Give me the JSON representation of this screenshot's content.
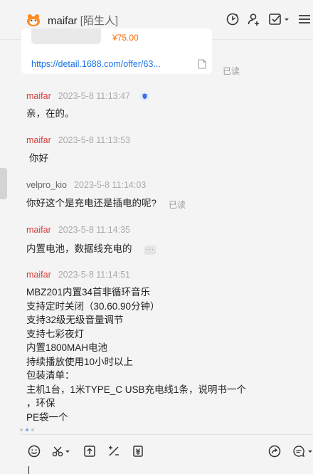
{
  "header": {
    "name": "maifar",
    "tag": "[陌生人]"
  },
  "product_card": {
    "price": "¥75.00",
    "link": "https://detail.1688.com/offer/63...",
    "read_status": "已读"
  },
  "messages": [
    {
      "sender": "maifar",
      "time": "2023-5-8 11:13:47",
      "text": "亲，在的。"
    },
    {
      "sender": "maifar",
      "time": "2023-5-8 11:13:53",
      "text": "你好"
    },
    {
      "sender": "velpro_kio",
      "time": "2023-5-8 11:14:03",
      "text": "你好这个是充电还是插电的呢?",
      "read_status": "已读"
    },
    {
      "sender": "maifar",
      "time": "2023-5-8 11:14:35",
      "text": "内置电池，数据线充电的"
    },
    {
      "sender": "maifar",
      "time": "2023-5-8 11:14:51",
      "lines": [
        "MBZ201内置34首非循环音乐",
        "支持定时关闭（30.60.90分钟）",
        "支持32级无级音量调节",
        "支持七彩夜灯",
        "内置1800MAH电池",
        "持续播放使用10小时以上",
        "包装清单：",
        "主机1台，1米TYPE_C USB充电线1条，说明书一个",
        "，环保",
        "PE袋一个"
      ]
    }
  ],
  "colors": {
    "seller_name": "#d43f3a",
    "link": "#1a73e8",
    "price": "#ff6a00"
  }
}
